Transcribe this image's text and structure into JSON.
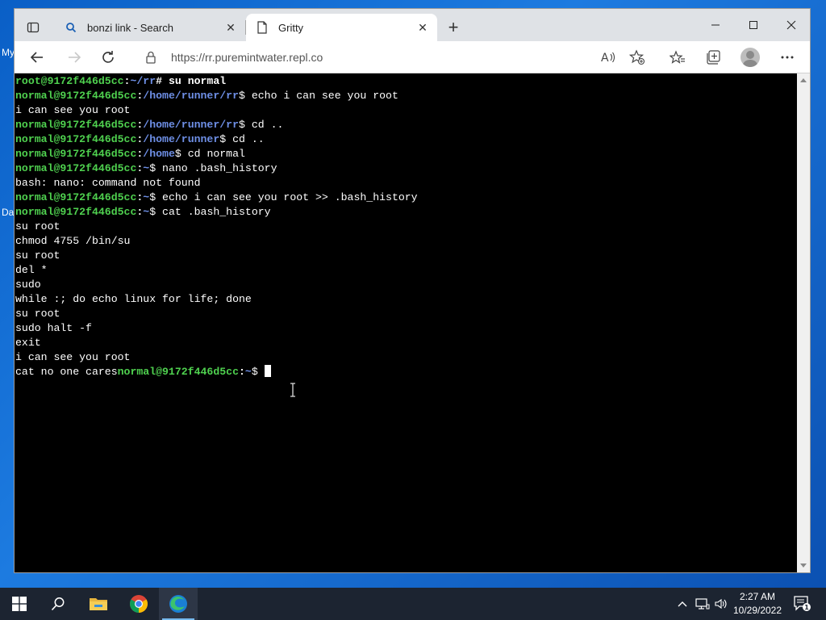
{
  "desktop": {
    "label_top": "My",
    "label_mid": "Da"
  },
  "browser": {
    "tabs": [
      {
        "title": "bonzi link - Search",
        "active": false
      },
      {
        "title": "Gritty",
        "active": true
      }
    ],
    "close_glyph": "✕",
    "new_tab_glyph": "+",
    "address": "https://rr.puremintwater.repl.co"
  },
  "terminal": {
    "lines": [
      [
        {
          "t": "root@9172f446d5cc",
          "c": "g"
        },
        {
          "t": ":",
          "c": "w"
        },
        {
          "t": "~/rr",
          "c": "b"
        },
        {
          "t": "# su normal",
          "c": "w"
        }
      ],
      [
        {
          "t": "normal@9172f446d5cc",
          "c": "g"
        },
        {
          "t": ":",
          "c": "w"
        },
        {
          "t": "/home/runner/rr",
          "c": "b"
        },
        {
          "t": "$ echo i can see you root",
          "c": ""
        }
      ],
      [
        {
          "t": "i can see you root",
          "c": ""
        }
      ],
      [
        {
          "t": "normal@9172f446d5cc",
          "c": "g"
        },
        {
          "t": ":",
          "c": "w"
        },
        {
          "t": "/home/runner/rr",
          "c": "b"
        },
        {
          "t": "$ cd ..",
          "c": ""
        }
      ],
      [
        {
          "t": "normal@9172f446d5cc",
          "c": "g"
        },
        {
          "t": ":",
          "c": "w"
        },
        {
          "t": "/home/runner",
          "c": "b"
        },
        {
          "t": "$ cd ..",
          "c": ""
        }
      ],
      [
        {
          "t": "normal@9172f446d5cc",
          "c": "g"
        },
        {
          "t": ":",
          "c": "w"
        },
        {
          "t": "/home",
          "c": "b"
        },
        {
          "t": "$ cd normal",
          "c": ""
        }
      ],
      [
        {
          "t": "normal@9172f446d5cc",
          "c": "g"
        },
        {
          "t": ":",
          "c": "w"
        },
        {
          "t": "~",
          "c": "b"
        },
        {
          "t": "$ nano .bash_history",
          "c": ""
        }
      ],
      [
        {
          "t": "bash: nano: command not found",
          "c": ""
        }
      ],
      [
        {
          "t": "normal@9172f446d5cc",
          "c": "g"
        },
        {
          "t": ":",
          "c": "w"
        },
        {
          "t": "~",
          "c": "b"
        },
        {
          "t": "$ echo i can see you root >> .bash_history",
          "c": ""
        }
      ],
      [
        {
          "t": "normal@9172f446d5cc",
          "c": "g"
        },
        {
          "t": ":",
          "c": "w"
        },
        {
          "t": "~",
          "c": "b"
        },
        {
          "t": "$ cat .bash_history",
          "c": ""
        }
      ],
      [
        {
          "t": "su root",
          "c": ""
        }
      ],
      [
        {
          "t": "chmod 4755 /bin/su",
          "c": ""
        }
      ],
      [
        {
          "t": "su root",
          "c": ""
        }
      ],
      [
        {
          "t": "del *",
          "c": ""
        }
      ],
      [
        {
          "t": "sudo",
          "c": ""
        }
      ],
      [
        {
          "t": "while :; do echo linux for life; done",
          "c": ""
        }
      ],
      [
        {
          "t": "su root",
          "c": ""
        }
      ],
      [
        {
          "t": "sudo halt -f",
          "c": ""
        }
      ],
      [
        {
          "t": "exit",
          "c": ""
        }
      ],
      [
        {
          "t": "i can see you root",
          "c": ""
        }
      ],
      [
        {
          "t": "cat no one cares",
          "c": ""
        },
        {
          "t": "normal@9172f446d5cc",
          "c": "g"
        },
        {
          "t": ":",
          "c": "w"
        },
        {
          "t": "~",
          "c": "b"
        },
        {
          "t": "$ ",
          "c": ""
        }
      ]
    ]
  },
  "taskbar": {
    "clock_time": "2:27 AM",
    "clock_date": "10/29/2022",
    "notification_count": "1"
  },
  "colors": {
    "prompt_user": "#4fd14f",
    "prompt_path": "#6e8fe6",
    "terminal_bg": "#000000",
    "taskbar_bg": "#1c2431",
    "accent": "#0a5fc6"
  },
  "icons": [
    "tab-actions-icon",
    "search-favicon",
    "page-favicon",
    "back-icon",
    "forward-icon",
    "refresh-icon",
    "lock-icon",
    "read-aloud-icon",
    "add-favorite-icon",
    "favorites-icon",
    "collections-icon",
    "profile-icon",
    "more-icon",
    "minimize-icon",
    "maximize-icon",
    "close-window-icon",
    "windows-start-icon",
    "search-taskbar-icon",
    "file-explorer-icon",
    "chrome-icon",
    "edge-icon",
    "chevron-up-icon",
    "network-icon",
    "volume-icon",
    "notification-icon"
  ]
}
